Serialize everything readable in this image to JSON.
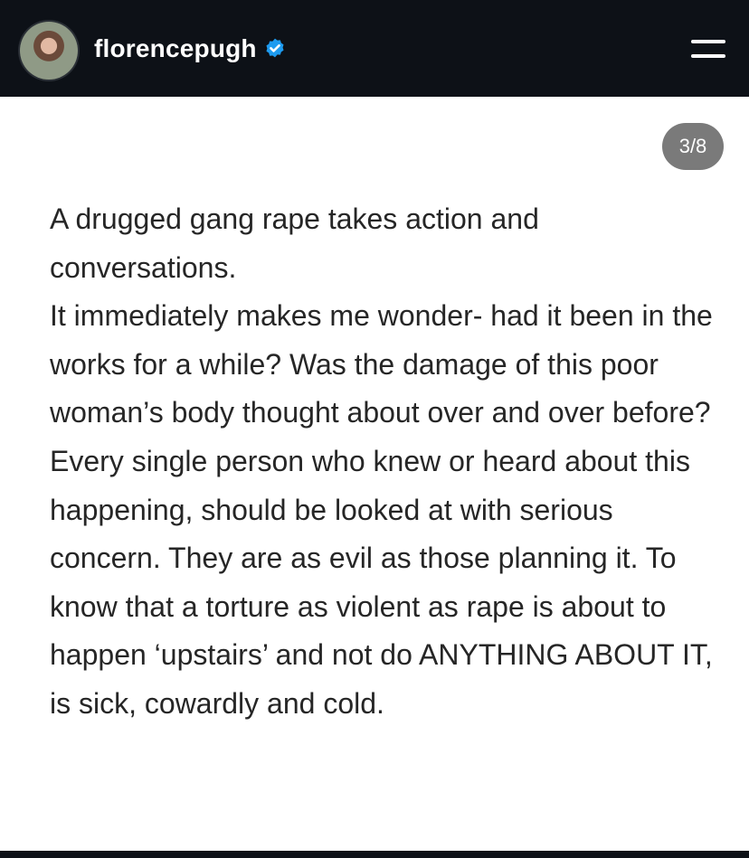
{
  "header": {
    "username": "florencepugh",
    "verified_icon": "verified-badge-icon",
    "menu_icon": "hamburger-menu-icon"
  },
  "slide_counter": "3/8",
  "post": {
    "paragraphs": [
      "A drugged gang rape takes action and conversations.",
      "It immediately makes me wonder- had it been in the works for a while? Was the damage of this poor woman’s body thought about over and over before?",
      "Every single person who knew or heard about this happening, should be looked at with serious concern. They are as evil as those planning it. To know that a torture as violent as rape is about to happen ‘upstairs’ and not do ANYTHING ABOUT IT, is sick, cowardly and cold."
    ]
  },
  "colors": {
    "header_bg": "#0d1117",
    "verified_blue": "#1d9bf0",
    "counter_bg": "#7a7a7a",
    "text": "#262626"
  }
}
